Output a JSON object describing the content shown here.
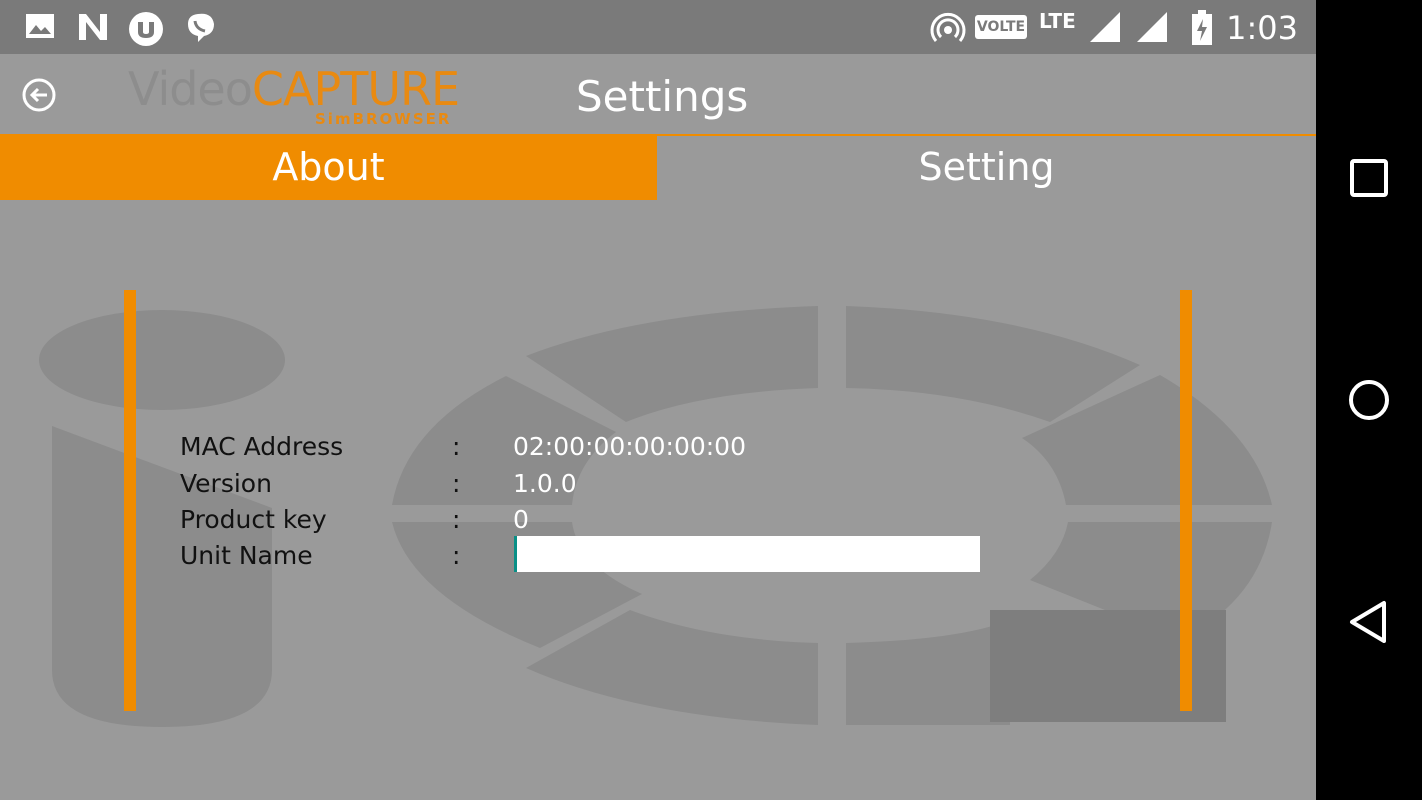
{
  "status_bar": {
    "time": "1:03",
    "volte_label": "VOLTE",
    "network_label": "LTE",
    "icons": [
      "image-icon",
      "n-app-icon",
      "utorrent-icon",
      "viber-icon",
      "hotspot-icon",
      "volte-icon",
      "signal-icon",
      "signal-icon",
      "battery-charging-icon"
    ]
  },
  "app_bar": {
    "logo_video": "Video",
    "logo_capture": "CAPTURE",
    "logo_sub": "SimBROWSER",
    "title": "Settings",
    "back_icon": "back-arrow-icon"
  },
  "tabs": [
    {
      "label": "About",
      "active": true
    },
    {
      "label": "Setting",
      "active": false
    }
  ],
  "info": {
    "rows": [
      {
        "label": "MAC Address",
        "sep": ":",
        "value": "02:00:00:00:00:00"
      },
      {
        "label": "Version",
        "sep": ":",
        "value": "1.0.0"
      },
      {
        "label": "Product key",
        "sep": ":",
        "value": "0"
      },
      {
        "label": "Unit Name",
        "sep": ":",
        "value": ""
      }
    ]
  },
  "nav_bar": {
    "icons": [
      "recents-square-icon",
      "home-circle-icon",
      "back-triangle-icon"
    ]
  },
  "colors": {
    "accent": "#f08c00",
    "background": "#9a9a9a",
    "status_bar": "#7a7a7a",
    "input_cursor": "#0a8f86"
  }
}
